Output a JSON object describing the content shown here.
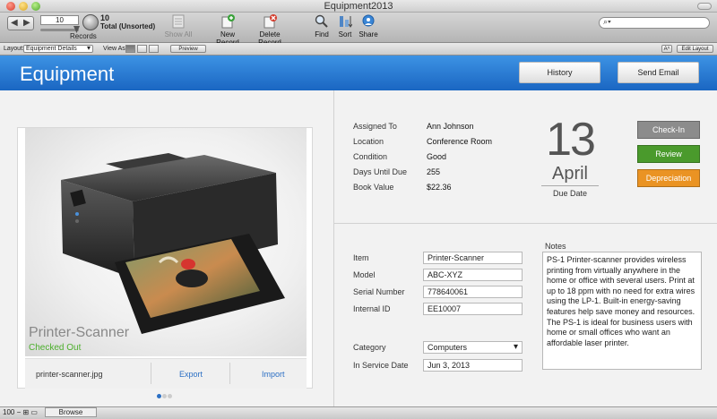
{
  "window": {
    "title": "Equipment2013"
  },
  "toolbar": {
    "record_number": "10",
    "records_label": "Records",
    "total_count": "10",
    "total_status": "Total (Unsorted)",
    "show_all": "Show All",
    "new_record": "New Record",
    "delete_record": "Delete Record",
    "find": "Find",
    "sort": "Sort",
    "share": "Share"
  },
  "layoutbar": {
    "layout_label": "Layout:",
    "layout_value": "Equipment Details",
    "view_as_label": "View As:",
    "preview": "Preview",
    "font_size": "Aᴬ",
    "edit_layout": "Edit Layout"
  },
  "header": {
    "title": "Equipment",
    "history_button": "History",
    "send_email_button": "Send Email"
  },
  "card": {
    "name": "Printer-Scanner",
    "status": "Checked Out",
    "filename": "printer-scanner.jpg",
    "export": "Export",
    "import": "Import"
  },
  "summary": {
    "assigned_to_label": "Assigned To",
    "assigned_to": "Ann Johnson",
    "location_label": "Location",
    "location": "Conference Room",
    "condition_label": "Condition",
    "condition": "Good",
    "days_until_due_label": "Days Until Due",
    "days_until_due": "255",
    "book_value_label": "Book Value",
    "book_value": "$22.36"
  },
  "due": {
    "day": "13",
    "month": "April",
    "label": "Due Date"
  },
  "actions": {
    "check_in": "Check-In",
    "review": "Review",
    "depreciation": "Depreciation",
    "colors": {
      "check_in": "#8c8c8c",
      "review": "#4a9a2c",
      "depreciation": "#ea9323"
    }
  },
  "details": {
    "item_label": "Item",
    "item": "Printer-Scanner",
    "model_label": "Model",
    "model": "ABC-XYZ",
    "serial_label": "Serial Number",
    "serial": "778640061",
    "internal_id_label": "Internal ID",
    "internal_id": "EE10007",
    "category_label": "Category",
    "category": "Computers",
    "in_service_label": "In Service Date",
    "in_service": "Jun 3, 2013"
  },
  "notes": {
    "label": "Notes",
    "text": "PS-1 Printer-scanner provides wireless printing from virtually anywhere in the home or office with several users. Print at up to 18 ppm with no need for extra wires using the LP-1. Built-in energy-saving features help save money and resources. The PS-1 is ideal for business users with home or small offices who want an affordable laser printer."
  },
  "statusbar": {
    "zoom": "100",
    "mode": "Browse"
  },
  "theme": {
    "header_blue": "#2a7bd6",
    "link_blue": "#2b6fc4",
    "status_green": "#4caf2c"
  }
}
